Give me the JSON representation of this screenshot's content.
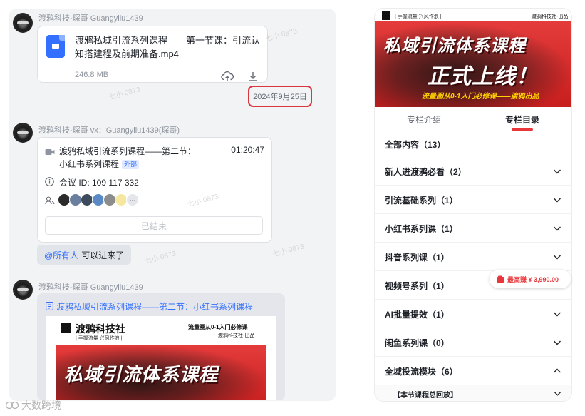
{
  "chat": {
    "messages": [
      {
        "sender": "渡鸦科技-琛哥 Guangyliu1439",
        "file": {
          "name": "渡鸦私域引流系列课程——第一节课：引流认知搭建程及前期准备.mp4",
          "size": "246.8 MB"
        }
      },
      {
        "date": "2024年9月25日"
      },
      {
        "sender": "渡鸦科技-琛哥 vx：Guangyliu1439(琛哥)",
        "meeting": {
          "title": "渡鸦私域引流系列课程——第二节：小红书系列课程",
          "tag": "外部",
          "duration": "01:20:47",
          "id_text": "会议 ID: 109 117 332",
          "ended_label": "已结束"
        }
      },
      {
        "mention": "@所有人",
        "text": "可以进来了"
      },
      {
        "sender": "渡鸦科技-琛哥 Guangyliu1439",
        "doc": {
          "title": "渡鸦私域引流系列课程——第二节：小红书系列课程",
          "poster": {
            "brand": "渡鸦科技社",
            "slogan": "| 手握流量  兴风作浪 |",
            "tagline": "流量圈从0-1入门必修课",
            "publisher": "渡鸦科技社-出品",
            "headline": "私域引流体系课程"
          }
        }
      }
    ]
  },
  "course": {
    "header": {
      "slogan": "| 手握流量  兴风作浪 |",
      "publisher": "渡鸦科技社-出品",
      "headline_1": "私域引流体系课程",
      "headline_2": "正式上线！",
      "tagline": "流量圈从0-1入门必修课——渡鸦出品"
    },
    "tabs": [
      {
        "label": "专栏介绍",
        "active": false
      },
      {
        "label": "专栏目录",
        "active": true
      }
    ],
    "all_content": "全部内容（13）",
    "categories": [
      {
        "label": "新人进渡鸦必看（2）",
        "expanded": false
      },
      {
        "label": "引流基础系列（1）",
        "expanded": false
      },
      {
        "label": "小红书系列课（1）",
        "expanded": false
      },
      {
        "label": "抖音系列课（1）",
        "expanded": false
      },
      {
        "label": "视频号系列（1）",
        "expanded": false
      },
      {
        "label": "AI批量提效（1）",
        "expanded": false
      },
      {
        "label": "闲鱼系列课（0）",
        "expanded": false
      },
      {
        "label": "全域投流模块（6）",
        "expanded": true
      }
    ],
    "sub_item": "【本节课程总回放】",
    "promo": "最高赚 ¥ 3,990.00"
  },
  "watermark": "七小 0873",
  "bottom_logo": "大数跨境",
  "colors": {
    "accent_blue": "#3370ff",
    "brand_red": "#e8363a",
    "date_outline": "#d9363e"
  }
}
